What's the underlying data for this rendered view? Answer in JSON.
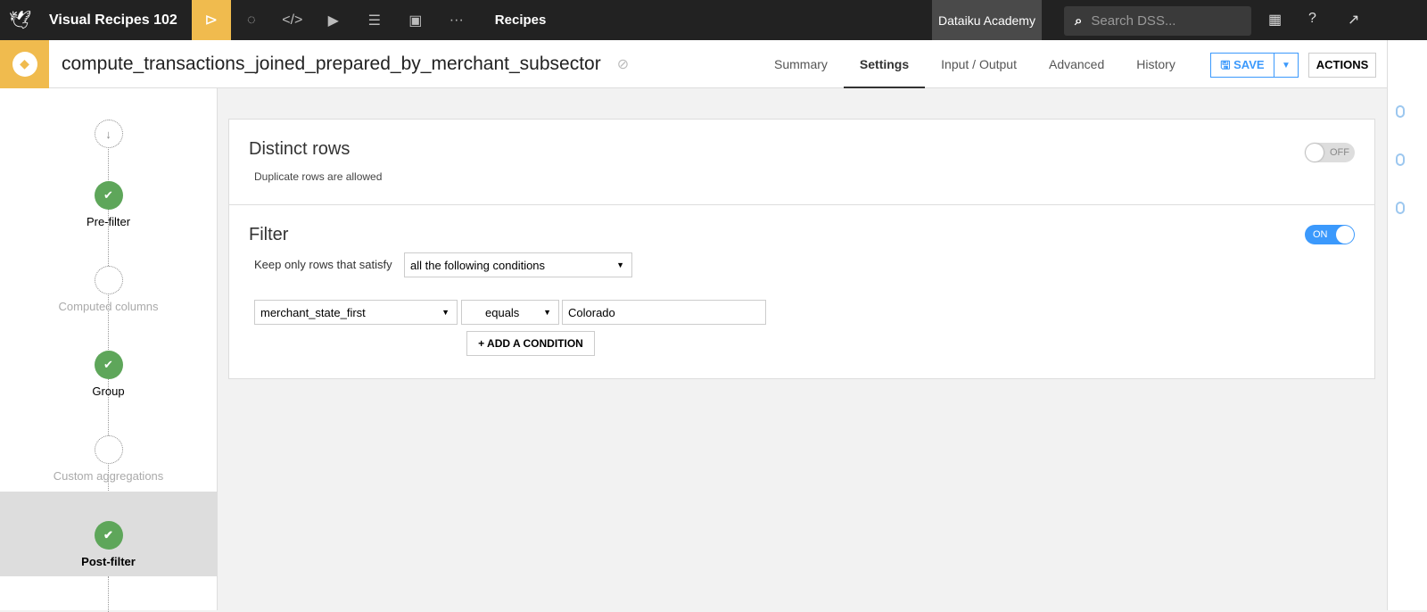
{
  "topbar": {
    "project": "Visual Recipes 102",
    "section": "Recipes",
    "academy": "Dataiku Academy",
    "search_placeholder": "Search DSS..."
  },
  "recipe": {
    "name": "compute_transactions_joined_prepared_by_merchant_subsector"
  },
  "tabs": [
    "Summary",
    "Settings",
    "Input / Output",
    "Advanced",
    "History"
  ],
  "buttons": {
    "save": "SAVE",
    "actions": "ACTIONS"
  },
  "steps": [
    {
      "label": "Pre-filter",
      "done": true
    },
    {
      "label": "Computed columns",
      "done": false
    },
    {
      "label": "Group",
      "done": true
    },
    {
      "label": "Custom aggregations",
      "done": false
    },
    {
      "label": "Post-filter",
      "done": true,
      "active": true
    }
  ],
  "distinct": {
    "title": "Distinct rows",
    "desc": "Duplicate rows are allowed",
    "toggle": "OFF"
  },
  "filter": {
    "title": "Filter",
    "toggle": "ON",
    "keep_label": "Keep only rows that satisfy",
    "mode": "all the following conditions",
    "condition": {
      "column": "merchant_state_first",
      "operator": "equals",
      "value": "Colorado"
    },
    "add": "+ ADD A CONDITION"
  },
  "colors": {
    "accent": "#f0bb4e",
    "ok": "#5ea65a",
    "blue": "#3b99fc"
  }
}
